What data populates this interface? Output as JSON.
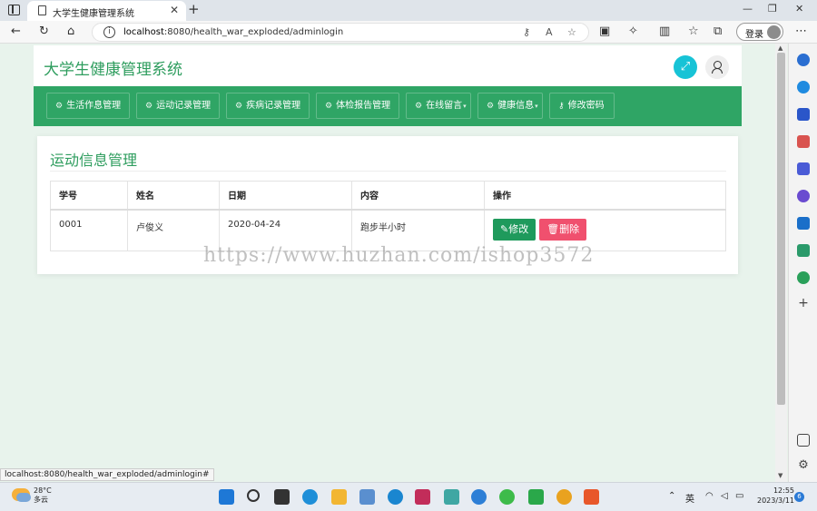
{
  "browser": {
    "tab_title": "大学生健康管理系统",
    "url_host": "localhost",
    "url_rest": ":8080/health_war_exploded/adminlogin",
    "login_label": "登录",
    "status_url": "localhost:8080/health_war_exploded/adminlogin#"
  },
  "app": {
    "title": "大学生健康管理系统",
    "menu": [
      {
        "label": "生活作息管理",
        "has_dropdown": true
      },
      {
        "label": "运动记录管理",
        "has_dropdown": true
      },
      {
        "label": "疾病记录管理",
        "has_dropdown": true
      },
      {
        "label": "体检报告管理",
        "has_dropdown": true
      },
      {
        "label": "在线留言",
        "has_dropdown": true
      },
      {
        "label": "健康信息",
        "has_dropdown": true
      },
      {
        "label": "修改密码",
        "has_dropdown": false
      }
    ],
    "colors": {
      "primary": "#2fa565",
      "title_green": "#2e9d5e",
      "edit": "#1f9a5c",
      "delete": "#f0506e",
      "fullscreen": "#17c3d6"
    }
  },
  "panel": {
    "title": "运动信息管理",
    "columns": [
      "学号",
      "姓名",
      "日期",
      "内容",
      "操作"
    ],
    "rows": [
      {
        "id": "0001",
        "name": "卢俊义",
        "date": "2020-04-24",
        "content": "跑步半小时"
      }
    ],
    "edit_label": "修改",
    "delete_label": "删除"
  },
  "watermark": "https://www.huzhan.com/ishop3572",
  "taskbar": {
    "temperature": "28°C",
    "weather": "多云",
    "ime": "英",
    "time": "12:55",
    "date": "2023/3/11",
    "notifications": "6"
  }
}
